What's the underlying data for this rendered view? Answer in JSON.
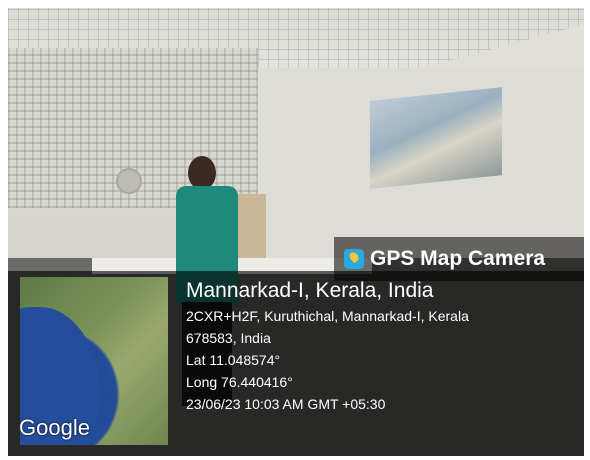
{
  "badge": {
    "label": "GPS Map Camera",
    "icon": "map-pin-icon"
  },
  "map": {
    "brand": "Google"
  },
  "location": {
    "title": "Mannarkad-I, Kerala, India",
    "address_line1": "2CXR+H2F, Kuruthichal, Mannarkad-I, Kerala",
    "address_line2": "678583, India",
    "lat": "Lat 11.048574°",
    "long": "Long 76.440416°",
    "datetime": "23/06/23 10:03 AM GMT +05:30"
  }
}
